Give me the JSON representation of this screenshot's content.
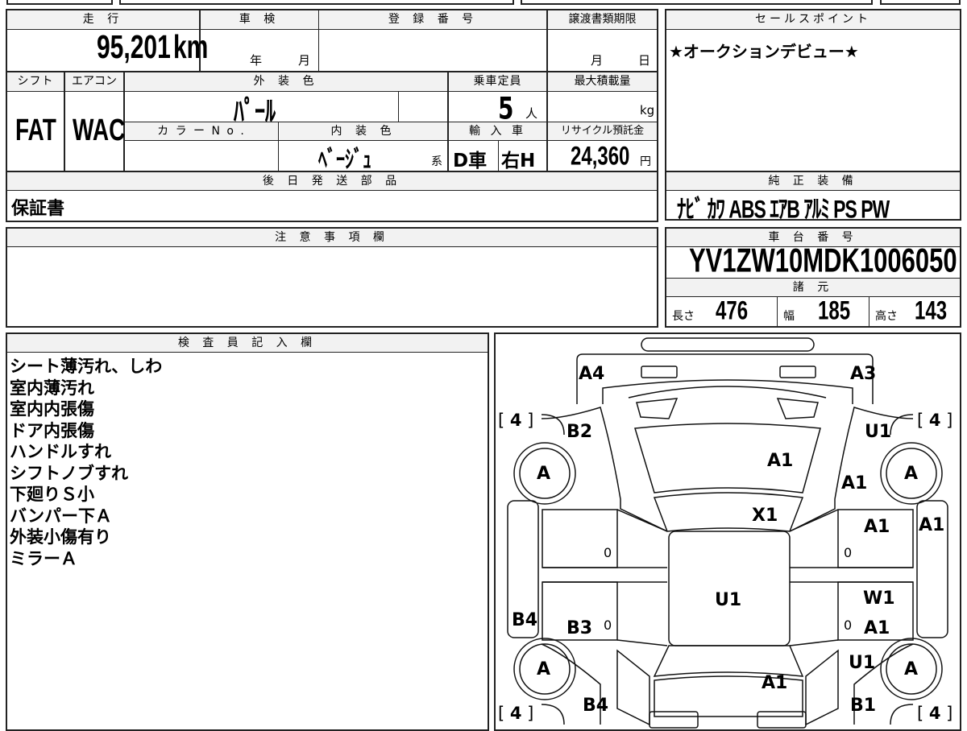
{
  "top_strip": {
    "cell1": "",
    "cell2": "",
    "cell3": "",
    "cell4": ""
  },
  "spec": {
    "headers": {
      "mileage": "走 行",
      "inspection": "車 検",
      "registration": "登 録 番 号",
      "transfer_deadline": "譲渡書類期限",
      "shift": "シフト",
      "aircon": "エアコン",
      "exterior_color": "外 装 色",
      "capacity": "乗車定員",
      "max_load": "最大積載量",
      "color_no": "カ ラ ー  N o .",
      "interior_color": "内 装 色",
      "import": "輸 入 車",
      "recycle": "リサイクル預託金"
    },
    "mileage": "95,201",
    "mileage_unit": "km",
    "inspection_year_unit": "年",
    "inspection_month_unit": "月",
    "registration_value": "",
    "deadline_month_unit": "月",
    "deadline_day_unit": "日",
    "shift": "FAT",
    "aircon": "WAC",
    "exterior_color": "ﾊﾟｰﾙ",
    "capacity": "5",
    "capacity_unit": "人",
    "max_load_unit": "kg",
    "color_no": "",
    "interior_color": "ﾍﾞｰｼﾞｭ",
    "interior_suffix": "系",
    "import_type": "D車",
    "steering": "右H",
    "recycle_fee": "24,360",
    "recycle_unit": "円"
  },
  "later_parts": {
    "header": "後 日 発 送 部 品",
    "value": "保証書"
  },
  "notes": {
    "header": "注 意 事 項 欄",
    "value": ""
  },
  "sales_points": {
    "header": "セールスポイント",
    "value": "★オークションデビュー★"
  },
  "equipment": {
    "header": "純 正 装 備",
    "value": "ﾅﾋﾞ ｶﾜ ABS ｴｱB ｱﾙﾐ PS PW"
  },
  "chassis": {
    "header": "車 台 番 号",
    "value": "YV1ZW10MDK1006050"
  },
  "dimensions": {
    "header": "諸 元",
    "length_label": "長さ",
    "length": "476",
    "width_label": "幅",
    "width": "185",
    "height_label": "高さ",
    "height": "143"
  },
  "inspector": {
    "header": "検 査 員 記 入 欄",
    "lines": [
      "シート薄汚れ、しわ",
      "室内薄汚れ",
      "室内内張傷",
      "ドア内張傷",
      "ハンドルすれ",
      "シフトノブすれ",
      "下廻りＳ小",
      "バンパー下Ａ",
      "外装小傷有り",
      "ミラーＡ"
    ]
  },
  "diagram": {
    "front_left_corner": "A4",
    "front_right_corner": "A3",
    "hood": "A1",
    "left_front_fender": "B2",
    "right_front_fender": "U1",
    "right_front_fender_2": "A1",
    "windshield": "X1",
    "roof": "U1",
    "right_front_door": "A1",
    "right_rocker": "A1",
    "right_rear_door_1": "W1",
    "right_rear_door_2": "A1",
    "left_rear_door": "B3",
    "left_rocker": "B4",
    "right_rear_fender": "U1",
    "trunk": "A1",
    "left_rear_corner": "B4",
    "right_rear_corner": "B1",
    "tyre_grade": "A",
    "tread": "4",
    "door_zero": "0"
  }
}
